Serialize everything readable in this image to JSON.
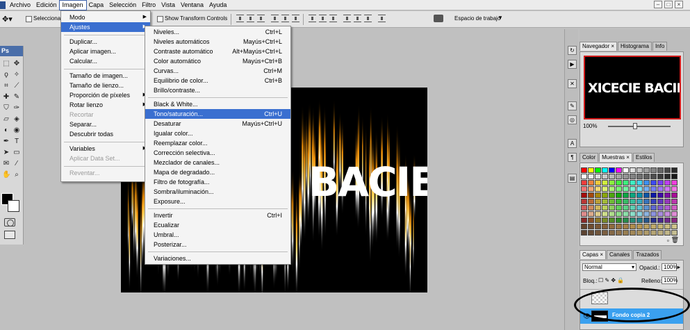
{
  "menubar": {
    "items": [
      "Archivo",
      "Edición",
      "Imagen",
      "Capa",
      "Selección",
      "Filtro",
      "Vista",
      "Ventana",
      "Ayuda"
    ],
    "active": "Imagen"
  },
  "window_controls": [
    "–",
    "□",
    "×"
  ],
  "optbar": {
    "select_label": "Seleccionar",
    "transform_label": "Show Transform Controls",
    "workspace_label": "Espacio de trabajo",
    "workspace_arrow": "▼"
  },
  "toolbox": {
    "title": "Ps",
    "tools": [
      {
        "icon": "marquee-icon",
        "glyph": "⬚"
      },
      {
        "icon": "move-icon",
        "glyph": "✥"
      },
      {
        "icon": "lasso-icon",
        "glyph": "ϙ"
      },
      {
        "icon": "magic-wand-icon",
        "glyph": "✧"
      },
      {
        "icon": "crop-icon",
        "glyph": "⌗"
      },
      {
        "icon": "slice-icon",
        "glyph": "⟋"
      },
      {
        "icon": "healing-icon",
        "glyph": "✚"
      },
      {
        "icon": "brush-icon",
        "glyph": "✎"
      },
      {
        "icon": "stamp-icon",
        "glyph": "⛉"
      },
      {
        "icon": "history-brush-icon",
        "glyph": "✑"
      },
      {
        "icon": "eraser-icon",
        "glyph": "▱"
      },
      {
        "icon": "bucket-icon",
        "glyph": "◈"
      },
      {
        "icon": "dodge-icon",
        "glyph": "◐"
      },
      {
        "icon": "sponge-icon",
        "glyph": "◉"
      },
      {
        "icon": "pen-icon",
        "glyph": "✒"
      },
      {
        "icon": "type-icon",
        "glyph": "T"
      },
      {
        "icon": "path-select-icon",
        "glyph": "➤"
      },
      {
        "icon": "shape-icon",
        "glyph": "▭"
      },
      {
        "icon": "notes-icon",
        "glyph": "✉"
      },
      {
        "icon": "eyedropper-icon",
        "glyph": "⁄"
      },
      {
        "icon": "hand-icon",
        "glyph": "✋"
      },
      {
        "icon": "zoom-icon",
        "glyph": "⌕"
      }
    ]
  },
  "canvas": {
    "text": "BACIEL"
  },
  "imagen_menu": [
    {
      "label": "Modo",
      "arrow": "▶"
    },
    {
      "label": "Ajustes",
      "arrow": "▶",
      "highlight": true
    },
    {
      "label": "Duplicar..."
    },
    {
      "label": "Aplicar imagen..."
    },
    {
      "label": "Calcular..."
    },
    {
      "label": "Tamaño de imagen..."
    },
    {
      "label": "Tamaño de lienzo..."
    },
    {
      "label": "Proporción de píxeles",
      "arrow": "▶"
    },
    {
      "label": "Rotar lienzo",
      "arrow": "▶"
    },
    {
      "label": "Recortar",
      "disabled": true
    },
    {
      "label": "Separar..."
    },
    {
      "label": "Descubrir todas"
    },
    {
      "label": "Variables",
      "arrow": "▶"
    },
    {
      "label": "Aplicar Data Set...",
      "disabled": true
    },
    {
      "label": "Reventar...",
      "disabled": true
    }
  ],
  "ajustes_menu": [
    {
      "label": "Niveles...",
      "shortcut": "Ctrl+L"
    },
    {
      "label": "Niveles automáticos",
      "shortcut": "Mayús+Ctrl+L"
    },
    {
      "label": "Contraste automático",
      "shortcut": "Alt+Mayús+Ctrl+L"
    },
    {
      "label": "Color automático",
      "shortcut": "Mayús+Ctrl+B"
    },
    {
      "label": "Curvas...",
      "shortcut": "Ctrl+M"
    },
    {
      "label": "Equilibrio de color...",
      "shortcut": "Ctrl+B"
    },
    {
      "label": "Brillo/contraste..."
    },
    {
      "label": "Black & White..."
    },
    {
      "label": "Tono/saturación...",
      "shortcut": "Ctrl+U",
      "highlight": true
    },
    {
      "label": "Desaturar",
      "shortcut": "Mayús+Ctrl+U"
    },
    {
      "label": "Igualar color..."
    },
    {
      "label": "Reemplazar color..."
    },
    {
      "label": "Corrección selectiva..."
    },
    {
      "label": "Mezclador de canales..."
    },
    {
      "label": "Mapa de degradado..."
    },
    {
      "label": "Filtro de fotografía..."
    },
    {
      "label": "Sombra/iluminación..."
    },
    {
      "label": "Exposure..."
    },
    {
      "label": "Invertir",
      "shortcut": "Ctrl+I"
    },
    {
      "label": "Ecualizar"
    },
    {
      "label": "Umbral..."
    },
    {
      "label": "Posterizar..."
    },
    {
      "label": "Variaciones..."
    }
  ],
  "navigator": {
    "tabs": [
      "Navegador ×",
      "Histograma",
      "Info"
    ],
    "thumb_text": "XICECIE BACIEL",
    "zoom": "100%"
  },
  "color_panel": {
    "tabs": [
      "Color",
      "Muestras ×",
      "Estilos"
    ]
  },
  "layers_panel": {
    "tabs": [
      "Capas ×",
      "Canales",
      "Trazados"
    ],
    "blend_mode": "Normal",
    "opacity_label": "Opacid.:",
    "opacity_value": "100%",
    "lock_label": "Bloq.:",
    "fill_label": "Relleno:",
    "fill_value": "100%",
    "selected_layer": "Fondo copia 2"
  },
  "colors": {
    "menu_highlight": "#3a6fd0",
    "layer_selected": "#3aa0ef",
    "navigator_border": "#d21a1a",
    "toolbox_header": "#4a6ea9"
  }
}
